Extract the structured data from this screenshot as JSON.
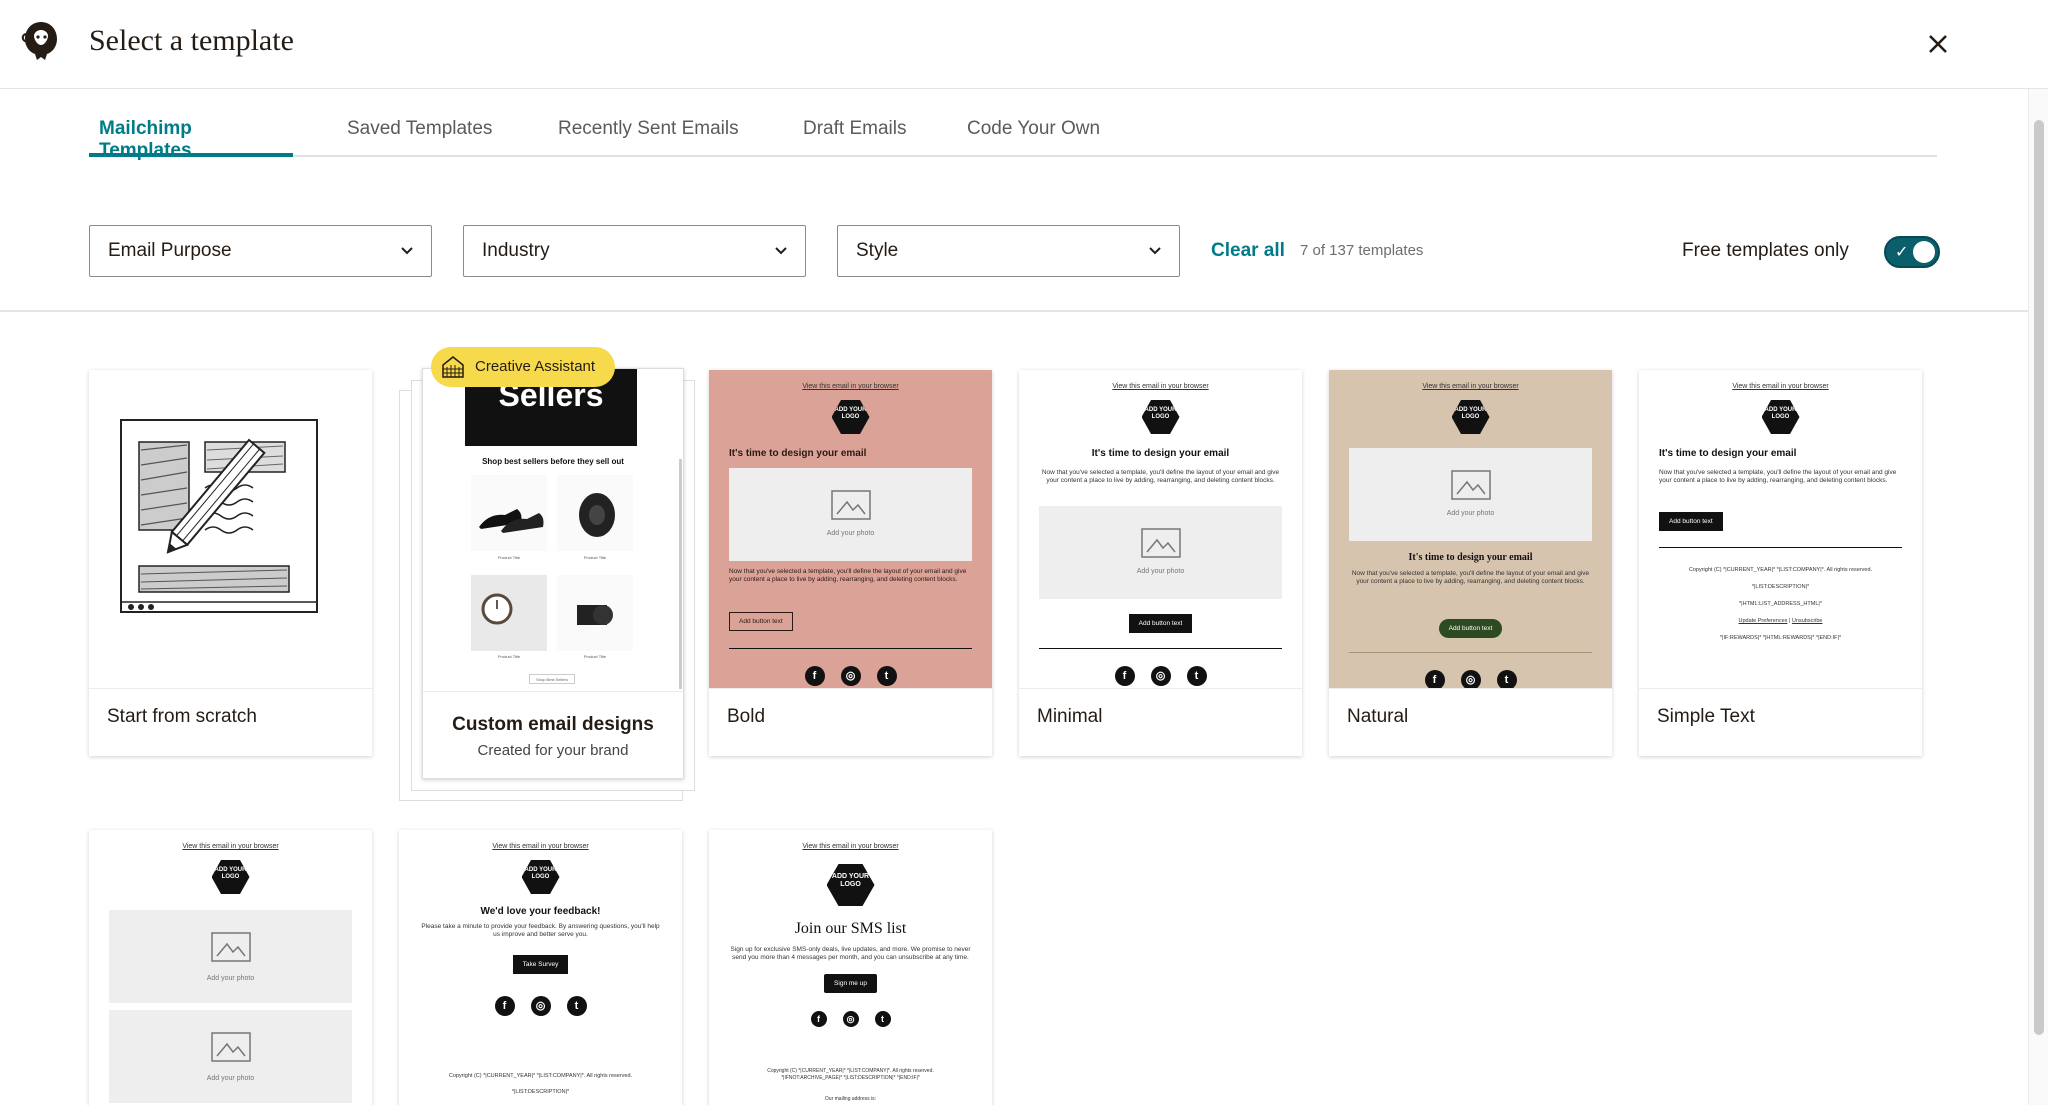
{
  "header": {
    "title": "Select a template"
  },
  "tabs": [
    {
      "label": "Mailchimp Templates",
      "active": true
    },
    {
      "label": "Saved Templates",
      "active": false
    },
    {
      "label": "Recently Sent Emails",
      "active": false
    },
    {
      "label": "Draft Emails",
      "active": false
    },
    {
      "label": "Code Your Own",
      "active": false
    }
  ],
  "filters": {
    "email_purpose": "Email Purpose",
    "industry": "Industry",
    "style": "Style",
    "clear_all": "Clear all",
    "count": "7 of 137 templates",
    "free_only_label": "Free templates only",
    "free_only_on": true
  },
  "cards": {
    "scratch": {
      "label": "Start from scratch"
    },
    "custom": {
      "badge": "Creative Assistant",
      "banner": "Sellers",
      "heading": "Shop best sellers before they sell out",
      "title": "Custom email designs",
      "subtitle": "Created for your brand",
      "product_title": "Product Title",
      "shop_button": "Shop Best Sellers"
    },
    "bold": {
      "label": "Bold"
    },
    "minimal": {
      "label": "Minimal"
    },
    "natural": {
      "label": "Natural"
    },
    "simple_text": {
      "label": "Simple Text"
    }
  },
  "preview": {
    "view_link": "View this email in your browser",
    "logo": "ADD YOUR LOGO",
    "heading": "It's time to design your email",
    "body": "Now that you've selected a template, you'll define the layout of your email and give your content a place to live by adding, rearranging, and deleting content blocks.",
    "photo": "Add your photo",
    "button": "Add button text",
    "feedback_heading": "We'd love your feedback!",
    "feedback_body": "Please take a minute to provide your feedback. By answering questions, you'll help us improve and better serve you.",
    "feedback_button": "Take Survey",
    "sms_heading": "Join our SMS list",
    "sms_body": "Sign up for exclusive SMS-only deals, live updates, and more. We promise to never send you more than 4 messages per month, and you can unsubscribe at any time.",
    "sms_button": "Sign me up",
    "footer_copyright": "Copyright (C) *|CURRENT_YEAR|* *|LIST:COMPANY|*. All rights reserved.",
    "footer_description": "*|LIST:DESCRIPTION|*",
    "footer_address": "*|HTML:LIST_ADDRESS_HTML|*",
    "footer_prefs": "Update Preferences",
    "footer_sep": "|",
    "footer_unsub": "Unsubscribe",
    "footer_rewards": "*|IF:REWARDS|* *|HTML:REWARDS|* *|END:IF|*",
    "footer_merge1": "Copyright (C) *|CURRENT_YEAR|* *|LIST:COMPANY|*. All rights reserved.",
    "footer_merge2": "*|IFNOT:ARCHIVE_PAGE|* *|LIST:DESCRIPTION|* *|END:IF|*",
    "mailing": "Our mailing address is:"
  },
  "colors": {
    "accent": "#007c89",
    "bold_bg": "#dba297",
    "natural_bg": "#d6c4ae",
    "badge_bg": "#f7d94c"
  }
}
